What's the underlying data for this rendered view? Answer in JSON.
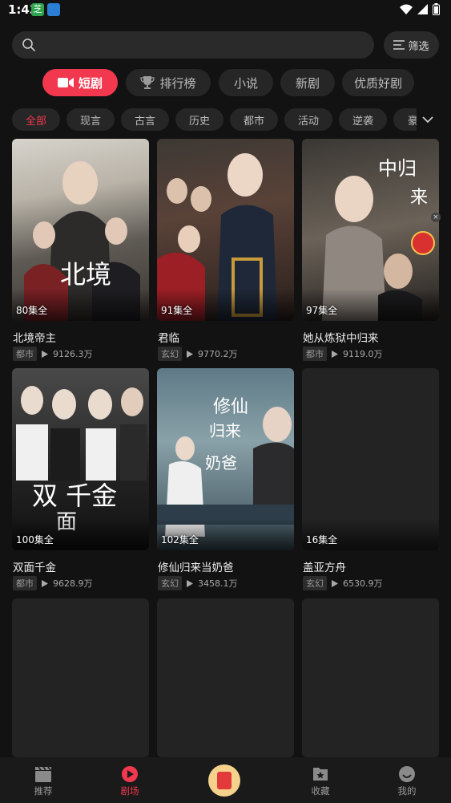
{
  "status_bar": {
    "time": "1:43",
    "app_icon_1_text": "芝"
  },
  "search": {
    "placeholder": ""
  },
  "filter": {
    "label": "筛选"
  },
  "main_tabs": [
    {
      "label": "短剧",
      "active": true
    },
    {
      "label": "排行榜",
      "active": false
    },
    {
      "label": "小说",
      "active": false
    },
    {
      "label": "新剧",
      "active": false
    },
    {
      "label": "优质好剧",
      "active": false
    }
  ],
  "sub_tabs": [
    "全部",
    "现言",
    "古言",
    "历史",
    "都市",
    "活动",
    "逆袭",
    "豪"
  ],
  "cards": [
    {
      "title": "北境帝主",
      "episodes": "80集全",
      "genre": "都市",
      "plays": "9126.3万"
    },
    {
      "title": "君临",
      "episodes": "91集全",
      "genre": "玄幻",
      "plays": "9770.2万"
    },
    {
      "title": "她从炼狱中归来",
      "episodes": "97集全",
      "genre": "都市",
      "plays": "9119.0万"
    },
    {
      "title": "双面千金",
      "episodes": "100集全",
      "genre": "都市",
      "plays": "9628.9万"
    },
    {
      "title": "修仙归来当奶爸",
      "episodes": "102集全",
      "genre": "玄幻",
      "plays": "3458.1万"
    },
    {
      "title": "盖亚方舟",
      "episodes": "16集全",
      "genre": "玄幻",
      "plays": "6530.9万"
    }
  ],
  "bottom_nav": [
    {
      "label": "推荐",
      "icon": "clapperboard-icon"
    },
    {
      "label": "剧场",
      "icon": "play-circle-icon",
      "active": true
    },
    {
      "label": "收藏",
      "icon": "bookmark-star-icon"
    },
    {
      "label": "我的",
      "icon": "face-icon"
    }
  ],
  "colors": {
    "accent": "#f1384f",
    "background": "#121212"
  }
}
